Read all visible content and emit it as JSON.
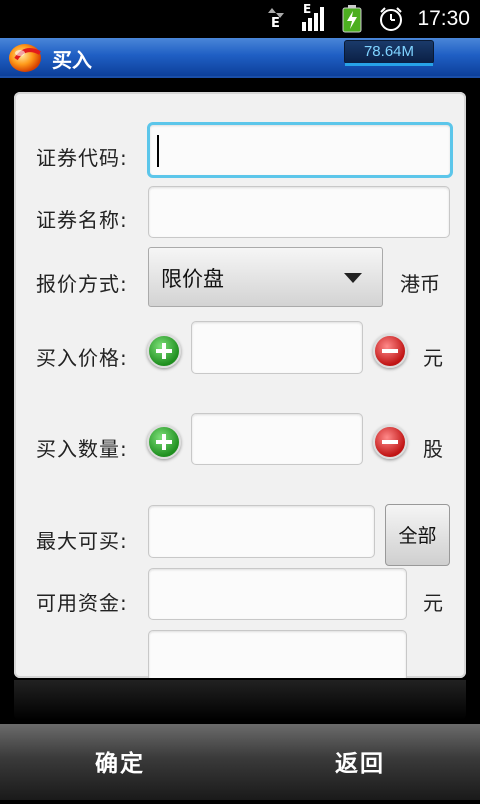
{
  "status": {
    "time": "17:30",
    "net_type_1": "E",
    "net_type_2": "E"
  },
  "title": {
    "text": "买入",
    "memory": "78.64M"
  },
  "form": {
    "code_label": "证券代码:",
    "code_value": "",
    "name_label": "证券名称:",
    "name_value": "",
    "quote_label": "报价方式:",
    "quote_value": "限价盘",
    "currency": "港币",
    "price_label": "买入价格:",
    "price_value": "",
    "price_unit": "元",
    "qty_label": "买入数量:",
    "qty_value": "",
    "qty_unit": "股",
    "max_label": "最大可买:",
    "max_value": "",
    "all_button": "全部",
    "funds_label": "可用资金:",
    "funds_value": "",
    "funds_unit": "元"
  },
  "bottom": {
    "confirm": "确定",
    "back": "返回"
  }
}
